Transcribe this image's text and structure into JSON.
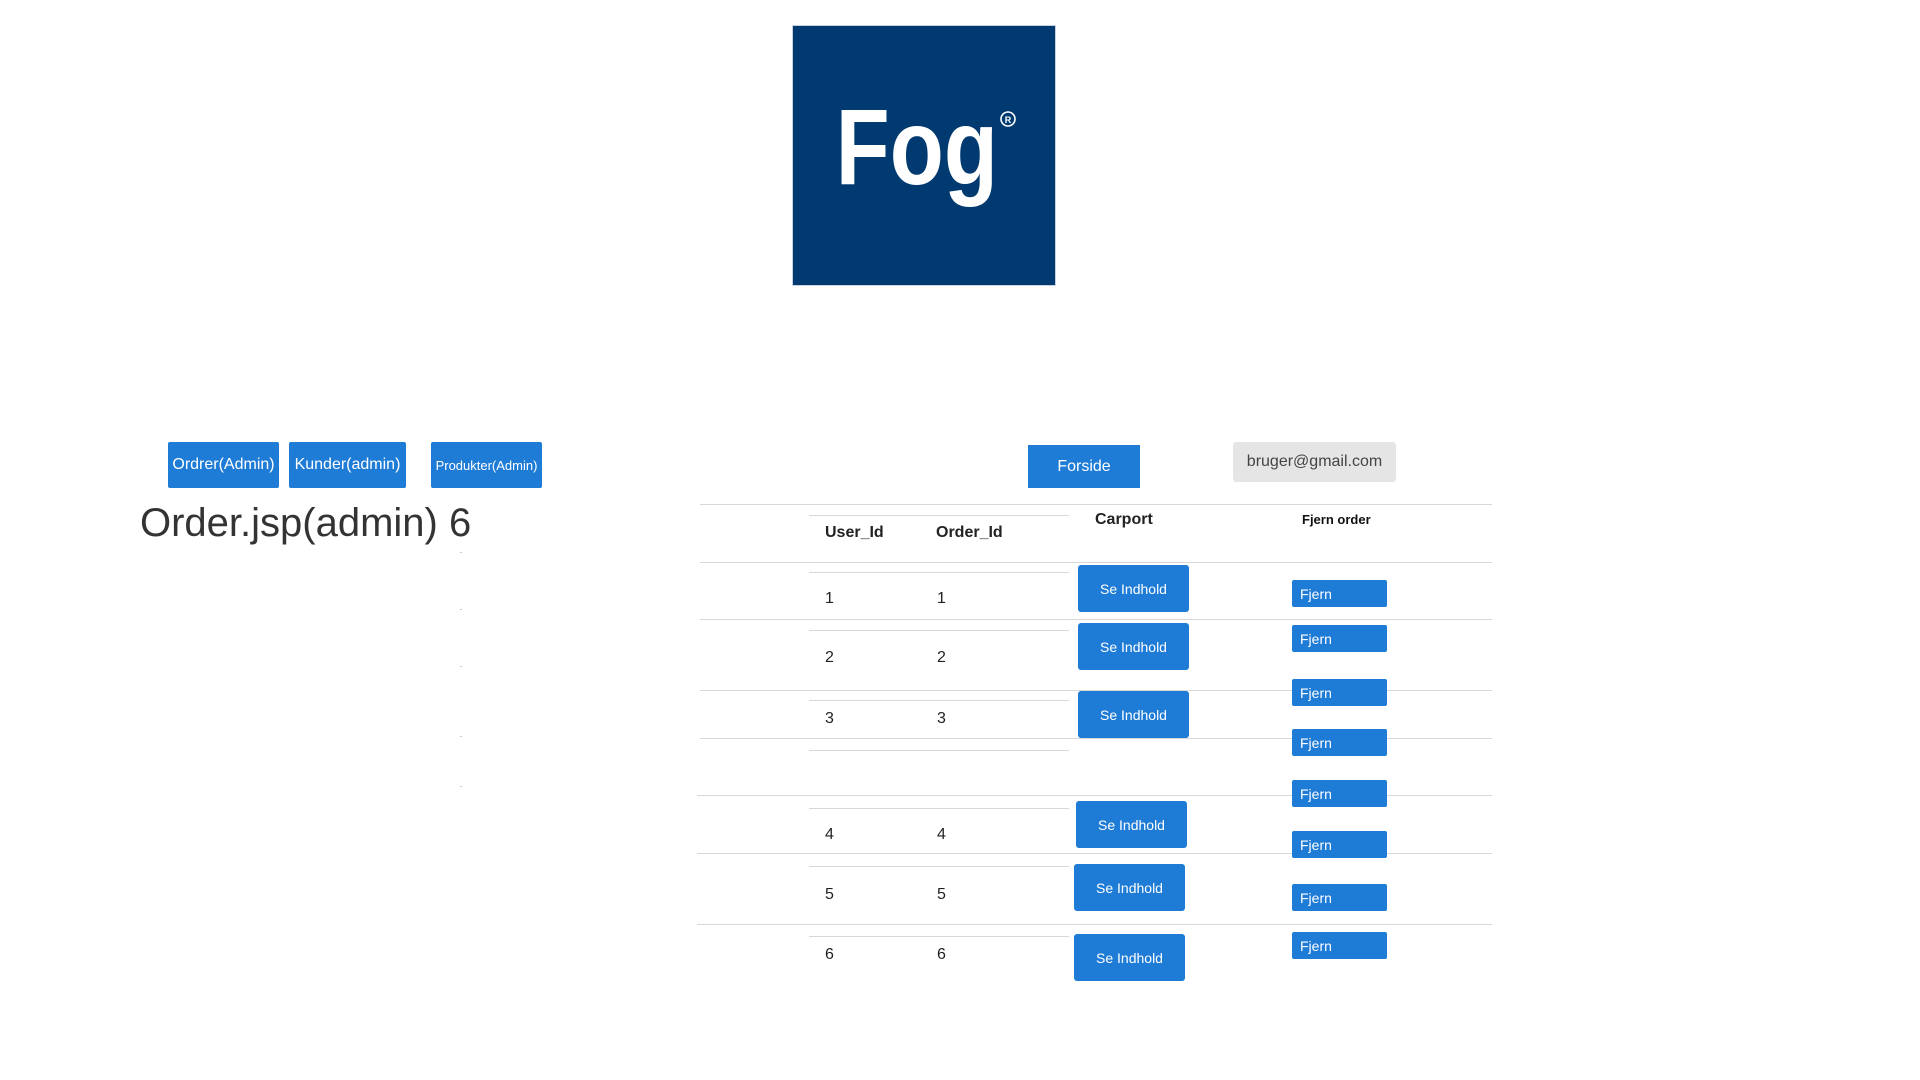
{
  "logo": {
    "text": "Fog",
    "mark": "®",
    "bg_color": "#003a70"
  },
  "nav": {
    "orders_label": "Ordrer(Admin)",
    "customers_label": "Kunder(admin)",
    "products_label": "Produkter(Admin)"
  },
  "header": {
    "home_label": "Forside",
    "user_email": "bruger@gmail.com"
  },
  "page": {
    "title": "Order.jsp(admin) 6"
  },
  "table": {
    "headers": {
      "user_id": "User_Id",
      "order_id": "Order_Id",
      "carport": "Carport",
      "remove": "Fjern order"
    },
    "rows": [
      {
        "user_id": "1",
        "order_id": "1",
        "view_label": "Se Indhold"
      },
      {
        "user_id": "2",
        "order_id": "2",
        "view_label": "Se Indhold"
      },
      {
        "user_id": "3",
        "order_id": "3",
        "view_label": "Se Indhold"
      },
      {
        "user_id": "4",
        "order_id": "4",
        "view_label": "Se Indhold"
      },
      {
        "user_id": "5",
        "order_id": "5",
        "view_label": "Se Indhold"
      },
      {
        "user_id": "6",
        "order_id": "6",
        "view_label": "Se Indhold"
      }
    ],
    "remove_buttons": [
      "Fjern",
      "Fjern",
      "Fjern",
      "Fjern",
      "Fjern",
      "Fjern",
      "Fjern",
      "Fjern"
    ]
  },
  "colors": {
    "primary": "#1e7bd6",
    "email_bg": "#e5e5e5"
  }
}
